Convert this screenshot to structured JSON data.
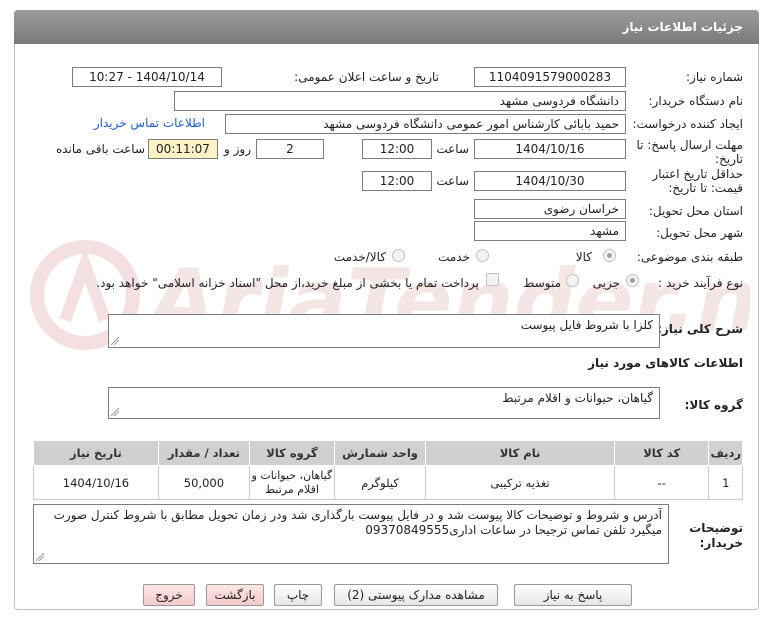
{
  "header": {
    "title": "جزئیات اطلاعات نیاز"
  },
  "fields": {
    "need_number_label": "شماره نیاز:",
    "need_number": "1104091579000283",
    "announce_label": "تاریخ و ساعت اعلان عمومی:",
    "announce_value": "1404/10/14 - 10:27",
    "buyer_org_label": "نام دستگاه خریدار:",
    "buyer_org": "دانشگاه فردوسی مشهد",
    "creator_label": "ایجاد کننده درخواست:",
    "creator": "حمید بابائی کارشناس امور عمومی دانشگاه فردوسی مشهد",
    "contact_link": "اطلاعات تماس خریدار",
    "deadline_label_1": "مهلت ارسال پاسخ: تا",
    "deadline_label_2": "تاریخ:",
    "deadline_date": "1404/10/16",
    "time_label": "ساعت",
    "deadline_time": "12:00",
    "days_value": "2",
    "days_label": "روز و",
    "remaining_time": "00:11:07",
    "remaining_label": "ساعت باقی مانده",
    "validity_label_1": "حداقل تاریخ اعتبار",
    "validity_label_2": "قیمت: تا تاریخ:",
    "validity_date": "1404/10/30",
    "validity_time_label": "ساعت",
    "validity_time": "12:00",
    "province_label": "استان محل تحویل:",
    "province": "خراسان رضوی",
    "city_label": "شهر محل تحویل:",
    "city": "مشهد",
    "category_label": "طبقه بندی موضوعی:",
    "category_options": [
      "کالا",
      "خدمت",
      "کالا/خدمت"
    ],
    "process_label": "نوع فرآیند خرید :",
    "process_options": [
      "جزیی",
      "متوسط"
    ],
    "treasury_text": "پرداخت تمام یا بخشی از مبلغ خرید،از محل \"اسناد خزانه اسلامی\" خواهد بود."
  },
  "summary": {
    "label": "شرح کلی نیاز:",
    "value": "کلزا با شروط فایل پیوست"
  },
  "goods_info": {
    "title": "اطلاعات کالاهای مورد نیاز"
  },
  "goods_group": {
    "label": "گروه کالا:",
    "value": "گیاهان، حیوانات و اقلام مرتبط"
  },
  "table": {
    "headers": [
      "ردیف",
      "کد کالا",
      "نام کالا",
      "واحد شمارش",
      "گروه کالا",
      "تعداد / مقدار",
      "تاریخ نیاز"
    ],
    "rows": [
      [
        "1",
        "--",
        "تغذیه ترکیبی",
        "کیلوگرم",
        "گیاهان، حیوانات و اقلام مرتبط",
        "50,000",
        "1404/10/16"
      ]
    ]
  },
  "buyer_notes": {
    "label_1": "توضیحات",
    "label_2": "خریدار:",
    "value": "آدرس و شروط  و توضیحات کالا پیوست شد و در فایل پیوست بارگذاری شد ودر زمان تحویل مطابق با شروط کنترل صورت میگیرد تلفن تماس  ترجیحا در ساعات اداری09370849555"
  },
  "buttons": {
    "reply": "پاسخ به نیاز",
    "docs": "مشاهده مدارک پیوستی (2)",
    "print": "چاپ",
    "back": "بازگشت",
    "exit": "خروج"
  },
  "colors": {
    "header_bg": "#8a8a8a",
    "link": "#1f5ec8",
    "remaining_bg": "#fbf3c5",
    "watermark": "#e4b0b0"
  }
}
